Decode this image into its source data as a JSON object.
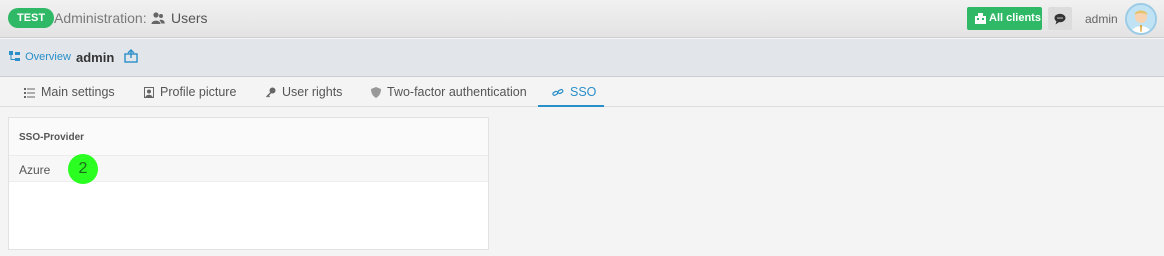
{
  "header": {
    "env_badge": "TEST",
    "section": "Administration:",
    "page": "Users",
    "all_clients_label": "All clients",
    "user_name": "admin"
  },
  "subheader": {
    "overview_label": "Overview",
    "record_title": "admin"
  },
  "tabs": [
    {
      "label": "Main settings",
      "icon": "list-icon",
      "active": false
    },
    {
      "label": "Profile picture",
      "icon": "image-icon",
      "active": false
    },
    {
      "label": "User rights",
      "icon": "key-icon",
      "active": false
    },
    {
      "label": "Two-factor authentication",
      "icon": "shield-icon",
      "active": false
    },
    {
      "label": "SSO",
      "icon": "link-icon",
      "active": true
    }
  ],
  "sso_table": {
    "column_header": "SSO-Provider",
    "rows": [
      {
        "provider": "Azure"
      }
    ]
  },
  "marker": {
    "label": "2"
  },
  "colors": {
    "accent": "#2a8fc9",
    "success": "#2fb865",
    "marker": "#2bff21"
  }
}
